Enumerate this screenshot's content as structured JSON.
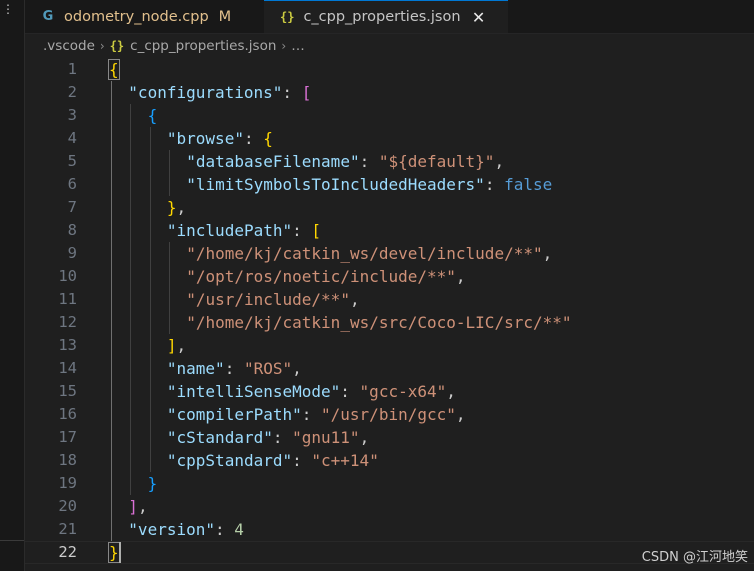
{
  "activity": {
    "more_glyph": "⋮"
  },
  "tabs": [
    {
      "icon": "c-cpp-icon",
      "glyph": "G",
      "label": "odometry_node.cpp",
      "status": "M"
    },
    {
      "icon": "json-braces-icon",
      "glyph": "{}",
      "label": "c_cpp_properties.json",
      "close_glyph": "✕",
      "active": true
    }
  ],
  "breadcrumb": {
    "folder": ".vscode",
    "json_glyph": "{}",
    "file": "c_cpp_properties.json",
    "ellipsis": "…",
    "sep": "›"
  },
  "editor": {
    "current_line": 22,
    "line_numbers": [
      "1",
      "2",
      "3",
      "4",
      "5",
      "6",
      "7",
      "8",
      "9",
      "10",
      "11",
      "12",
      "13",
      "14",
      "15",
      "16",
      "17",
      "18",
      "19",
      "20",
      "21",
      "22"
    ],
    "lines": [
      {
        "indent": 0,
        "tokens": [
          {
            "t": "{",
            "c": "y bm"
          }
        ]
      },
      {
        "indent": 1,
        "tokens": [
          {
            "t": "\"configurations\"",
            "c": "k"
          },
          {
            "t": ": ",
            "c": "p"
          },
          {
            "t": "[",
            "c": "m"
          }
        ]
      },
      {
        "indent": 2,
        "tokens": [
          {
            "t": "{",
            "c": "bl"
          }
        ]
      },
      {
        "indent": 3,
        "tokens": [
          {
            "t": "\"browse\"",
            "c": "k"
          },
          {
            "t": ": ",
            "c": "p"
          },
          {
            "t": "{",
            "c": "y"
          }
        ]
      },
      {
        "indent": 4,
        "tokens": [
          {
            "t": "\"databaseFilename\"",
            "c": "k"
          },
          {
            "t": ": ",
            "c": "p"
          },
          {
            "t": "\"${default}\"",
            "c": "s"
          },
          {
            "t": ",",
            "c": "p"
          }
        ]
      },
      {
        "indent": 4,
        "tokens": [
          {
            "t": "\"limitSymbolsToIncludedHeaders\"",
            "c": "k"
          },
          {
            "t": ": ",
            "c": "p"
          },
          {
            "t": "false",
            "c": "b"
          }
        ]
      },
      {
        "indent": 3,
        "tokens": [
          {
            "t": "}",
            "c": "y"
          },
          {
            "t": ",",
            "c": "p"
          }
        ]
      },
      {
        "indent": 3,
        "tokens": [
          {
            "t": "\"includePath\"",
            "c": "k"
          },
          {
            "t": ": ",
            "c": "p"
          },
          {
            "t": "[",
            "c": "y"
          }
        ]
      },
      {
        "indent": 4,
        "tokens": [
          {
            "t": "\"/home/kj/catkin_ws/devel/include/**\"",
            "c": "s"
          },
          {
            "t": ",",
            "c": "p"
          }
        ]
      },
      {
        "indent": 4,
        "tokens": [
          {
            "t": "\"/opt/ros/noetic/include/**\"",
            "c": "s"
          },
          {
            "t": ",",
            "c": "p"
          }
        ]
      },
      {
        "indent": 4,
        "tokens": [
          {
            "t": "\"/usr/include/**\"",
            "c": "s"
          },
          {
            "t": ",",
            "c": "p"
          }
        ]
      },
      {
        "indent": 4,
        "tokens": [
          {
            "t": "\"/home/kj/catkin_ws/src/Coco-LIC/src/**\"",
            "c": "s"
          }
        ]
      },
      {
        "indent": 3,
        "tokens": [
          {
            "t": "]",
            "c": "y"
          },
          {
            "t": ",",
            "c": "p"
          }
        ]
      },
      {
        "indent": 3,
        "tokens": [
          {
            "t": "\"name\"",
            "c": "k"
          },
          {
            "t": ": ",
            "c": "p"
          },
          {
            "t": "\"ROS\"",
            "c": "s"
          },
          {
            "t": ",",
            "c": "p"
          }
        ]
      },
      {
        "indent": 3,
        "tokens": [
          {
            "t": "\"intelliSenseMode\"",
            "c": "k"
          },
          {
            "t": ": ",
            "c": "p"
          },
          {
            "t": "\"gcc-x64\"",
            "c": "s"
          },
          {
            "t": ",",
            "c": "p"
          }
        ]
      },
      {
        "indent": 3,
        "tokens": [
          {
            "t": "\"compilerPath\"",
            "c": "k"
          },
          {
            "t": ": ",
            "c": "p"
          },
          {
            "t": "\"/usr/bin/gcc\"",
            "c": "s"
          },
          {
            "t": ",",
            "c": "p"
          }
        ]
      },
      {
        "indent": 3,
        "tokens": [
          {
            "t": "\"cStandard\"",
            "c": "k"
          },
          {
            "t": ": ",
            "c": "p"
          },
          {
            "t": "\"gnu11\"",
            "c": "s"
          },
          {
            "t": ",",
            "c": "p"
          }
        ]
      },
      {
        "indent": 3,
        "tokens": [
          {
            "t": "\"cppStandard\"",
            "c": "k"
          },
          {
            "t": ": ",
            "c": "p"
          },
          {
            "t": "\"c++14\"",
            "c": "s"
          }
        ]
      },
      {
        "indent": 2,
        "tokens": [
          {
            "t": "}",
            "c": "bl"
          }
        ]
      },
      {
        "indent": 1,
        "tokens": [
          {
            "t": "]",
            "c": "m"
          },
          {
            "t": ",",
            "c": "p"
          }
        ]
      },
      {
        "indent": 1,
        "tokens": [
          {
            "t": "\"version\"",
            "c": "k"
          },
          {
            "t": ": ",
            "c": "p"
          },
          {
            "t": "4",
            "c": "n"
          }
        ]
      },
      {
        "indent": 0,
        "tokens": [
          {
            "t": "}",
            "c": "y bm"
          }
        ]
      }
    ]
  },
  "watermark": "CSDN @江河地笑",
  "colors": {
    "background": "#1f1f1f",
    "key": "#9cdcfe",
    "string": "#ce9178",
    "number": "#b5cea8",
    "boolean": "#569cd6",
    "modified": "#e2c08d",
    "active_tab_border": "#0078d4"
  }
}
